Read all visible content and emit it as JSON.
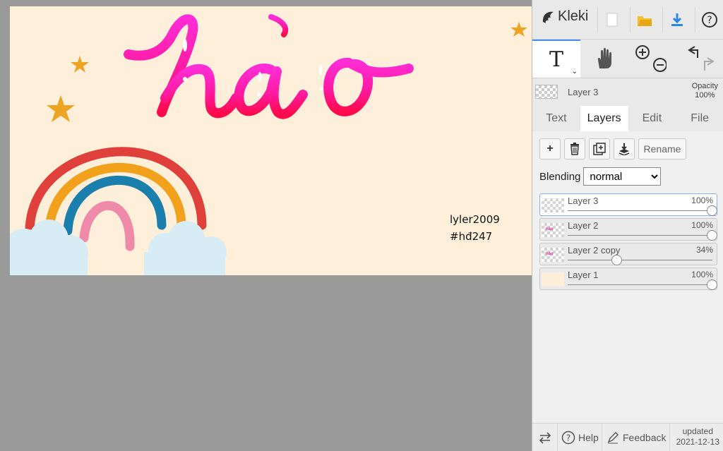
{
  "app": {
    "name": "Kleki"
  },
  "canvas": {
    "artwork_title": "hào",
    "signature_line1": "lyler2009",
    "signature_line2": "#hđ247",
    "colors": {
      "background": "#fdefd9",
      "title_top": "#ff2dd6",
      "title_bottom": "#ff0a4d",
      "rainbow_red": "#e0403b",
      "rainbow_orange": "#f2a11d",
      "rainbow_blue": "#1a7fad",
      "rainbow_pink": "#ef8aaa",
      "cloud": "#d8ecf5",
      "star": "#eda423"
    }
  },
  "toolbar": {
    "new_icon": "new-file-icon",
    "open_icon": "folder-icon",
    "download_icon": "download-icon",
    "help_icon": "help-icon"
  },
  "tools": {
    "text_tool_glyph": "T",
    "hand_icon": "hand-icon",
    "zoom_in_icon": "zoom-in-icon",
    "zoom_out_icon": "zoom-out-icon",
    "undo_icon": "undo-icon",
    "redo_icon": "redo-icon"
  },
  "current_layer": {
    "name": "Layer 3",
    "opacity_label": "Opacity",
    "opacity_value": "100%"
  },
  "tabs": [
    {
      "label": "Text",
      "active": false
    },
    {
      "label": "Layers",
      "active": true
    },
    {
      "label": "Edit",
      "active": false
    },
    {
      "label": "File",
      "active": false
    }
  ],
  "layer_actions": {
    "add": "+",
    "rename": "Rename"
  },
  "blending": {
    "label": "Blending",
    "value": "normal",
    "options": [
      "normal"
    ]
  },
  "layers": [
    {
      "name": "Layer 3",
      "opacity": "100%",
      "opacity_fraction": 1.0,
      "selected": true
    },
    {
      "name": "Layer 2",
      "opacity": "100%",
      "opacity_fraction": 1.0,
      "selected": false
    },
    {
      "name": "Layer 2 copy",
      "opacity": "34%",
      "opacity_fraction": 0.34,
      "selected": false
    },
    {
      "name": "Layer 1",
      "opacity": "100%",
      "opacity_fraction": 1.0,
      "selected": false
    }
  ],
  "bottom": {
    "help": "Help",
    "feedback": "Feedback",
    "updated_label": "updated",
    "updated_date": "2021-12-13"
  }
}
